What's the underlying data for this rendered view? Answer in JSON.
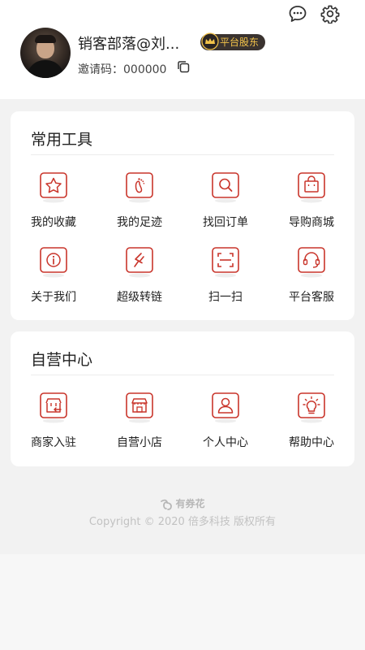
{
  "header": {
    "message_icon": "message-icon",
    "settings_icon": "gear-icon"
  },
  "profile": {
    "name": "销客部落@刘...",
    "badge": "平台股东",
    "invite_label": "邀请码：",
    "invite_code": "000000"
  },
  "tools": {
    "title": "常用工具",
    "items": [
      {
        "label": "我的收藏",
        "icon": "star-icon"
      },
      {
        "label": "我的足迹",
        "icon": "footprint-icon"
      },
      {
        "label": "找回订单",
        "icon": "search-icon"
      },
      {
        "label": "导购商城",
        "icon": "shopping-bag-icon"
      },
      {
        "label": "关于我们",
        "icon": "info-icon"
      },
      {
        "label": "超级转链",
        "icon": "link-icon"
      },
      {
        "label": "扫一扫",
        "icon": "scan-icon"
      },
      {
        "label": "平台客服",
        "icon": "headset-icon"
      }
    ]
  },
  "self_run": {
    "title": "自营中心",
    "items": [
      {
        "label": "商家入驻",
        "icon": "store-entry-icon"
      },
      {
        "label": "自营小店",
        "icon": "shop-icon"
      },
      {
        "label": "个人中心",
        "icon": "person-icon"
      },
      {
        "label": "帮助中心",
        "icon": "lightbulb-icon"
      }
    ]
  },
  "footer": {
    "brand": "有券花",
    "copyright": "Copyright © 2020 倍多科技 版权所有"
  },
  "colors": {
    "accent": "#c9352b",
    "badge_bg": "#3a3330",
    "badge_text": "#f3c34a"
  }
}
